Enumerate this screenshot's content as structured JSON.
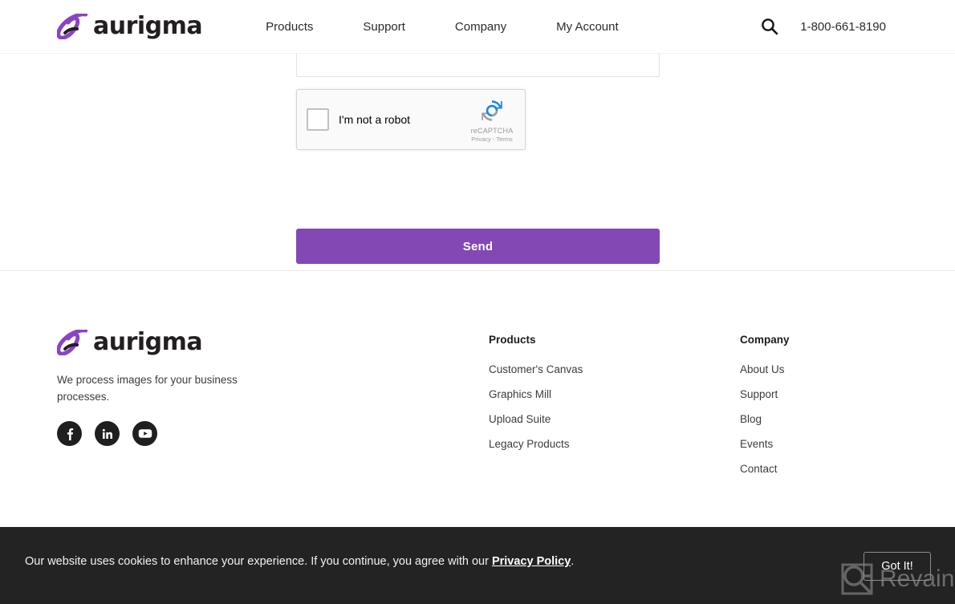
{
  "header": {
    "logo_text": "aurigma",
    "logo_icon": "aurigma-swoosh-logo",
    "nav": [
      {
        "label": "Products"
      },
      {
        "label": "Support"
      },
      {
        "label": "Company"
      },
      {
        "label": "My Account"
      }
    ],
    "search_icon": "search-icon",
    "phone": "1-800-661-8190"
  },
  "main": {
    "recaptcha": {
      "label": "I'm not a robot",
      "brand": "reCAPTCHA",
      "terms": "Privacy - Terms",
      "logo_icon": "recaptcha-logo-icon",
      "checked": false
    },
    "send_label": "Send",
    "send_color": "#8448b4"
  },
  "footer": {
    "logo_text": "aurigma",
    "tagline": "We process images for your business processes.",
    "socials": [
      {
        "name": "facebook-icon"
      },
      {
        "name": "linkedin-icon"
      },
      {
        "name": "youtube-icon"
      }
    ],
    "columns": [
      {
        "heading": "Products",
        "links": [
          {
            "label": "Customer's Canvas"
          },
          {
            "label": "Graphics Mill"
          },
          {
            "label": "Upload Suite"
          },
          {
            "label": "Legacy Products"
          }
        ]
      },
      {
        "heading": "Company",
        "links": [
          {
            "label": "About Us"
          },
          {
            "label": "Support"
          },
          {
            "label": "Blog"
          },
          {
            "label": "Events"
          },
          {
            "label": "Contact"
          }
        ]
      }
    ]
  },
  "cookie": {
    "text_before": "Our website uses cookies to enhance your experience. If you continue, you agree with our ",
    "link": "Privacy Policy",
    "text_after": ".",
    "button_label": "Got It!",
    "background": "#232323"
  },
  "watermark": {
    "text": "Revain",
    "icon": "revain-logo-icon"
  }
}
